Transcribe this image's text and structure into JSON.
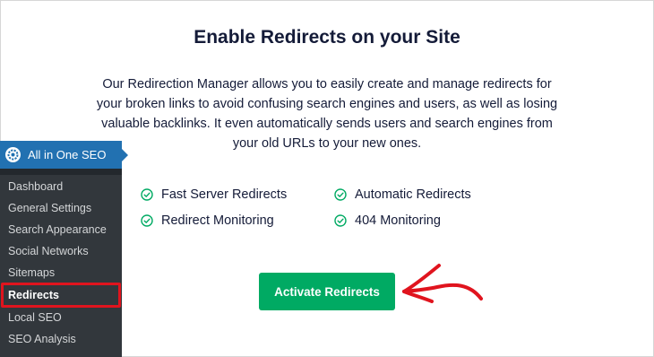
{
  "main": {
    "title": "Enable Redirects on your Site",
    "description": "Our Redirection Manager allows you to easily create and manage redirects for your broken links to avoid confusing search engines and users, as well as losing valuable backlinks. It even automatically sends users and search engines from your old URLs to your new ones.",
    "features": [
      {
        "label": "Fast Server Redirects",
        "icon": "check-circle-icon"
      },
      {
        "label": "Automatic Redirects",
        "icon": "check-circle-icon"
      },
      {
        "label": "Redirect Monitoring",
        "icon": "check-circle-icon"
      },
      {
        "label": "404 Monitoring",
        "icon": "check-circle-icon"
      }
    ],
    "activate_label": "Activate Redirects"
  },
  "sidebar": {
    "title": "All in One SEO",
    "items": [
      {
        "label": "Dashboard"
      },
      {
        "label": "General Settings"
      },
      {
        "label": "Search Appearance"
      },
      {
        "label": "Social Networks"
      },
      {
        "label": "Sitemaps"
      },
      {
        "label": "Redirects",
        "active": true
      },
      {
        "label": "Local SEO"
      },
      {
        "label": "SEO Analysis"
      }
    ]
  },
  "colors": {
    "accent_green": "#00aa63",
    "annotation_red": "#e0141e",
    "sidebar_blue": "#2271b1",
    "sidebar_dark": "#32373c",
    "text_dark": "#141b38"
  }
}
